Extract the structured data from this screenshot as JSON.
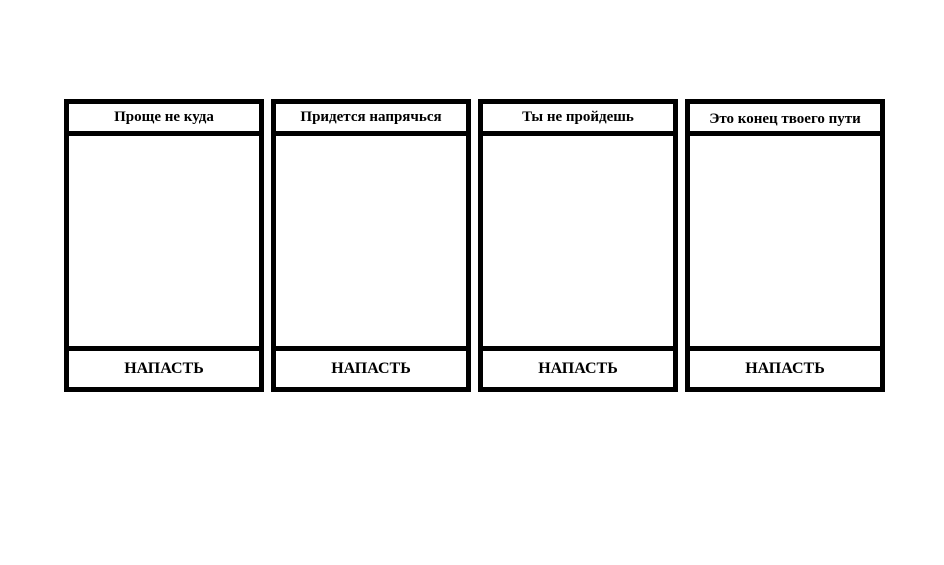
{
  "cards": [
    {
      "title": "Проще не куда",
      "button_label": "НАПАСТЬ"
    },
    {
      "title": "Придется напрячься",
      "button_label": "НАПАСТЬ"
    },
    {
      "title": "Ты не пройдешь",
      "button_label": "НАПАСТЬ"
    },
    {
      "title": "Это конец твоего пути",
      "button_label": "НАПАСТЬ"
    }
  ]
}
